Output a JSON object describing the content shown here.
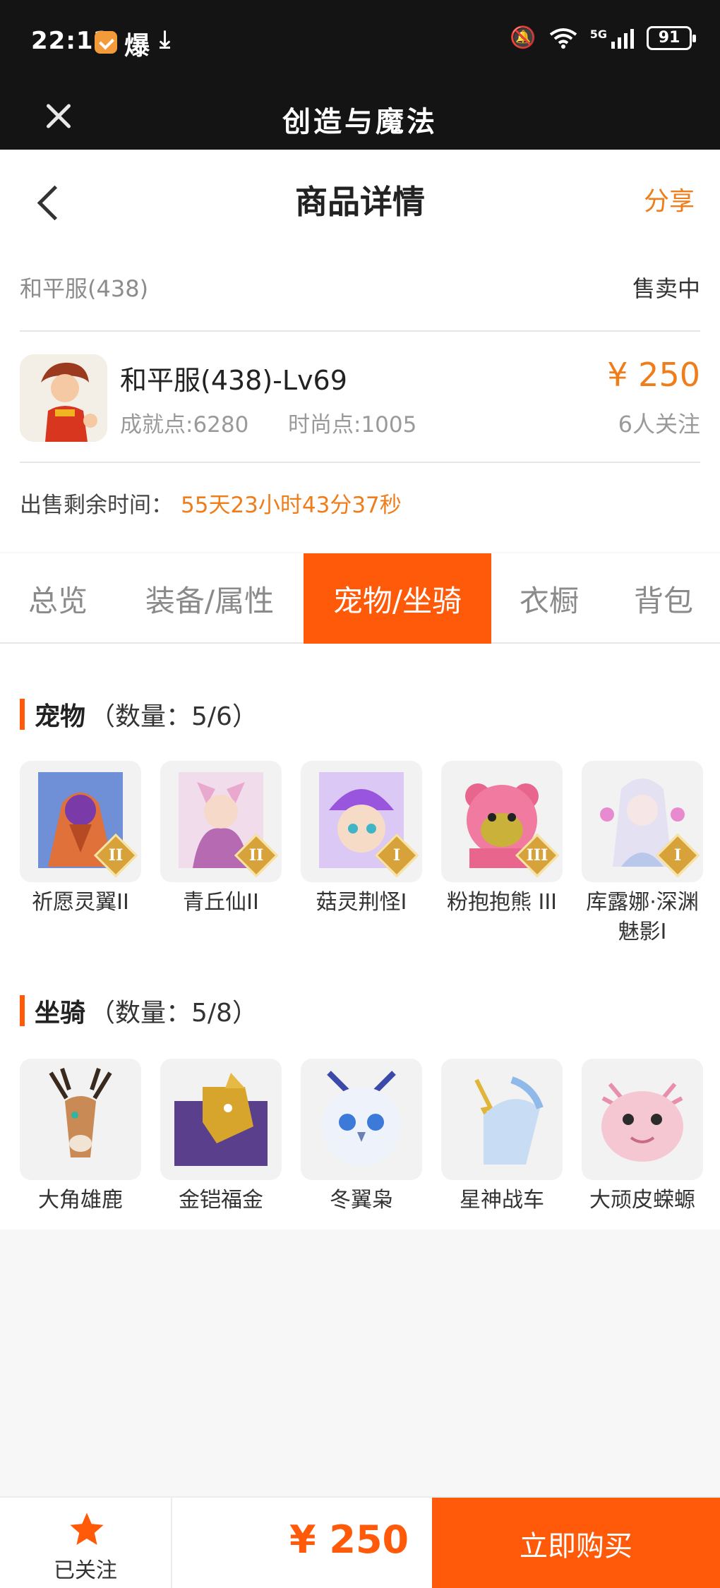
{
  "status_bar": {
    "time": "22:12",
    "boom_text": "爆",
    "network": "5G",
    "battery": "91"
  },
  "app_bar": {
    "title": "创造与魔法"
  },
  "nav": {
    "title": "商品详情",
    "share": "分享"
  },
  "product": {
    "server": "和平服(438)",
    "status": "售卖中",
    "name": "和平服(438)-Lv69",
    "achievement": "成就点:6280",
    "fashion": "时尚点:1005",
    "price": "¥ 250",
    "watchers": "6人关注",
    "remaining_label": "出售剩余时间：",
    "remaining_value": "55天23小时43分37秒"
  },
  "tabs": [
    {
      "label": "总览",
      "active": false
    },
    {
      "label": "装备/属性",
      "active": false
    },
    {
      "label": "宠物/坐骑",
      "active": true
    },
    {
      "label": "衣橱",
      "active": false
    },
    {
      "label": "背包",
      "active": false
    }
  ],
  "pets": {
    "title": "宠物",
    "count": "（数量：5/6）",
    "items": [
      {
        "name": "祈愿灵翼II",
        "rank": "II",
        "icon": "winged-bird-pet-icon",
        "color": "#7aa2e0"
      },
      {
        "name": "青丘仙II",
        "rank": "II",
        "icon": "fox-fairy-pet-icon",
        "color": "#e8b7d6"
      },
      {
        "name": "菇灵荆怪I",
        "rank": "I",
        "icon": "mushroom-sprite-pet-icon",
        "color": "#9b6be0"
      },
      {
        "name": "粉抱抱熊 III",
        "rank": "III",
        "icon": "pink-bear-pet-icon",
        "color": "#f07aa0"
      },
      {
        "name": "库露娜·深渊魅影I",
        "rank": "I",
        "icon": "abyss-phantom-pet-icon",
        "color": "#d9d4ee"
      }
    ]
  },
  "mounts": {
    "title": "坐骑",
    "count": "（数量：5/8）",
    "items": [
      {
        "name": "大角雄鹿",
        "icon": "great-stag-mount-icon",
        "color": "#c98a55"
      },
      {
        "name": "金铠福金",
        "icon": "golden-armor-mount-icon",
        "color": "#6b4a9e"
      },
      {
        "name": "冬翼枭",
        "icon": "winter-owl-mount-icon",
        "color": "#dfe9f7"
      },
      {
        "name": "星神战车",
        "icon": "star-chariot-mount-icon",
        "color": "#a6c9ee"
      },
      {
        "name": "大顽皮蝾螈",
        "icon": "axolotl-mount-icon",
        "color": "#f5c7d2"
      }
    ]
  },
  "bottom": {
    "follow_label": "已关注",
    "price": "¥ 250",
    "buy_label": "立即购买"
  },
  "colors": {
    "accent": "#ff5a0a",
    "price": "#ef7d1a",
    "rank_badge": "#d7a23a"
  }
}
